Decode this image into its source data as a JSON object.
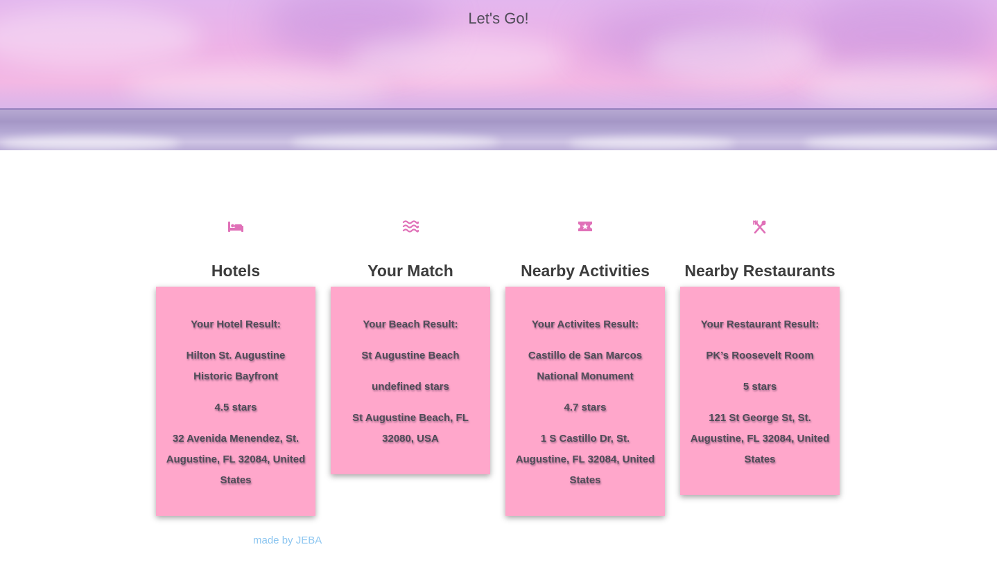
{
  "hero": {
    "title": "Let's Go!"
  },
  "columns": [
    {
      "icon": "bed-icon",
      "heading": "Hotels",
      "result_label": "Your Hotel Result:",
      "name": "Hilton St. Augustine Historic Bayfront",
      "rating": "4.5 stars",
      "address": "32 Avenida Menendez, St. Augustine, FL 32084, United States"
    },
    {
      "icon": "water-icon",
      "heading": "Your Match",
      "result_label": "Your Beach Result:",
      "name": "St Augustine Beach",
      "rating": "undefined stars",
      "address": "St Augustine Beach, FL 32080, USA"
    },
    {
      "icon": "ticket-icon",
      "heading": "Nearby Activities",
      "result_label": "Your Activites Result:",
      "name": "Castillo de San Marcos National Monument",
      "rating": "4.7 stars",
      "address": "1 S Castillo Dr, St. Augustine, FL 32084, United States"
    },
    {
      "icon": "utensils-icon",
      "heading": "Nearby Restaurants",
      "result_label": "Your Restaurant Result:",
      "name": "PK’s Roosevelt Room",
      "rating": "5 stars",
      "address": "121 St George St, St. Augustine, FL 32084, United States"
    }
  ],
  "footer": {
    "text": "made by JEBA"
  },
  "colors": {
    "card_background": "#ffa7cb",
    "icon_color": "#e071b8",
    "footer_link": "#8bc5f0"
  }
}
